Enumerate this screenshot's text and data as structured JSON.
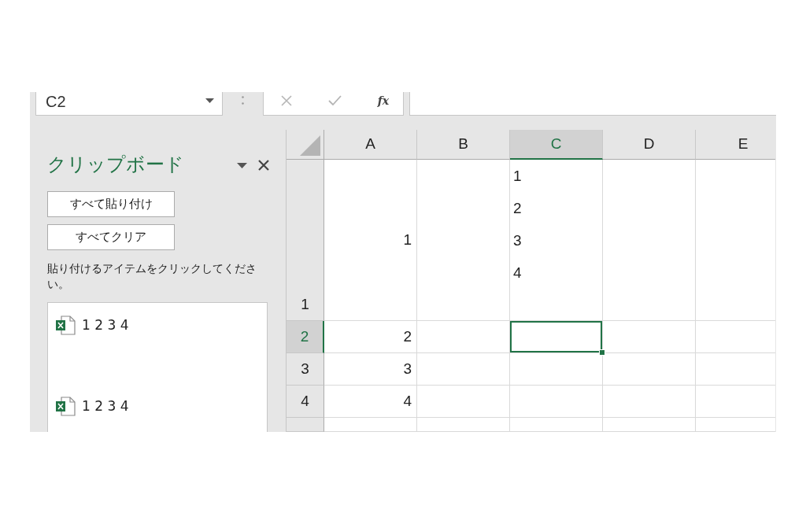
{
  "formula_bar": {
    "name_box": "C2",
    "function_button": "fx"
  },
  "clipboard_pane": {
    "title": "クリップボード",
    "buttons": [
      "すべて貼り付け",
      "すべてクリア"
    ],
    "instruction": "貼り付けるアイテムをクリックしてください。",
    "items": [
      {
        "text": "1 2 3 4"
      },
      {
        "text": "1 2 3 4"
      }
    ]
  },
  "sheet": {
    "columns": [
      {
        "label": "A",
        "selected": false
      },
      {
        "label": "B",
        "selected": false
      },
      {
        "label": "C",
        "selected": true
      },
      {
        "label": "D",
        "selected": false
      },
      {
        "label": "E",
        "selected": false
      }
    ],
    "rows": [
      {
        "header": "1",
        "selected": false,
        "cells": [
          {
            "kind": "number",
            "text": "1",
            "selected": false
          },
          {
            "selected": false
          },
          {
            "kind": "text",
            "text": "1\n2\n3\n4",
            "selected": false
          },
          {
            "selected": false
          },
          {
            "selected": false
          }
        ]
      },
      {
        "header": "2",
        "selected": true,
        "cells": [
          {
            "kind": "number",
            "text": "2",
            "selected": false
          },
          {
            "selected": false
          },
          {
            "selected": true
          },
          {
            "selected": false
          },
          {
            "selected": false
          }
        ]
      },
      {
        "header": "3",
        "selected": false,
        "cells": [
          {
            "kind": "number",
            "text": "3",
            "selected": false
          },
          {
            "selected": false
          },
          {
            "selected": false
          },
          {
            "selected": false
          },
          {
            "selected": false
          }
        ]
      },
      {
        "header": "4",
        "selected": false,
        "cells": [
          {
            "kind": "number",
            "text": "4",
            "selected": false
          },
          {
            "selected": false
          },
          {
            "selected": false
          },
          {
            "selected": false
          },
          {
            "selected": false
          }
        ]
      },
      {
        "selected": false,
        "cells": [
          {
            "selected": false
          },
          {
            "selected": false
          },
          {
            "selected": false
          },
          {
            "selected": false
          },
          {
            "selected": false
          }
        ]
      }
    ]
  }
}
